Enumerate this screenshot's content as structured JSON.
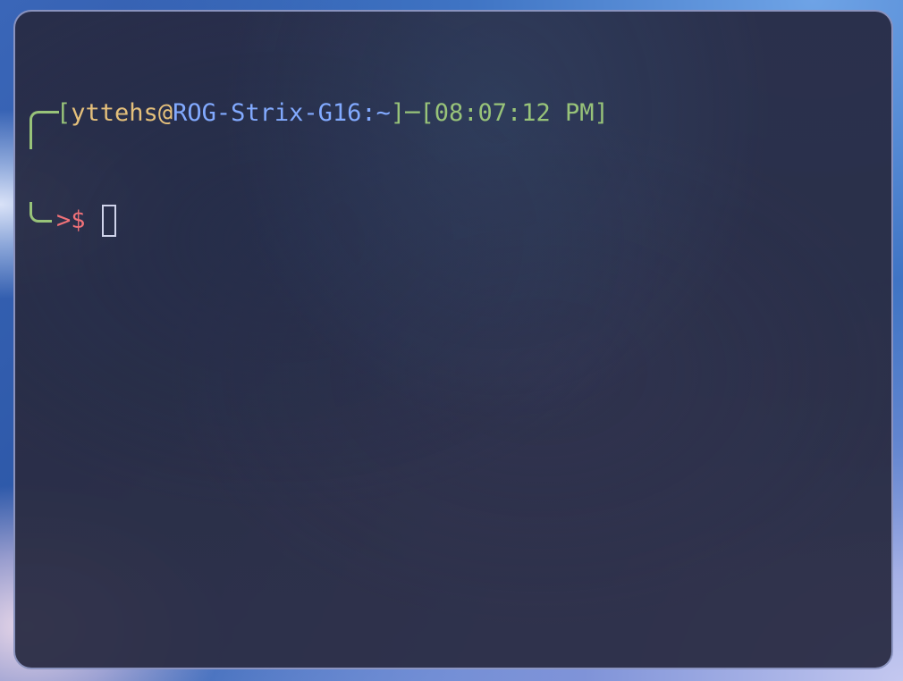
{
  "terminal": {
    "prompt_line1": {
      "open_bracket": "[",
      "user": "yttehs",
      "at": "@",
      "host": "ROG-Strix-G16",
      "path": ":~",
      "close_bracket": "]",
      "dash": "─",
      "time_block": "[08:07:12 PM]"
    },
    "prompt_line2": {
      "arrow": ">",
      "symbol": "$"
    }
  },
  "colors": {
    "connector": "#98c379",
    "user": "#e5c07b",
    "host": "#82aaff",
    "symbol": "#f07178",
    "background": "#2a2d44"
  }
}
